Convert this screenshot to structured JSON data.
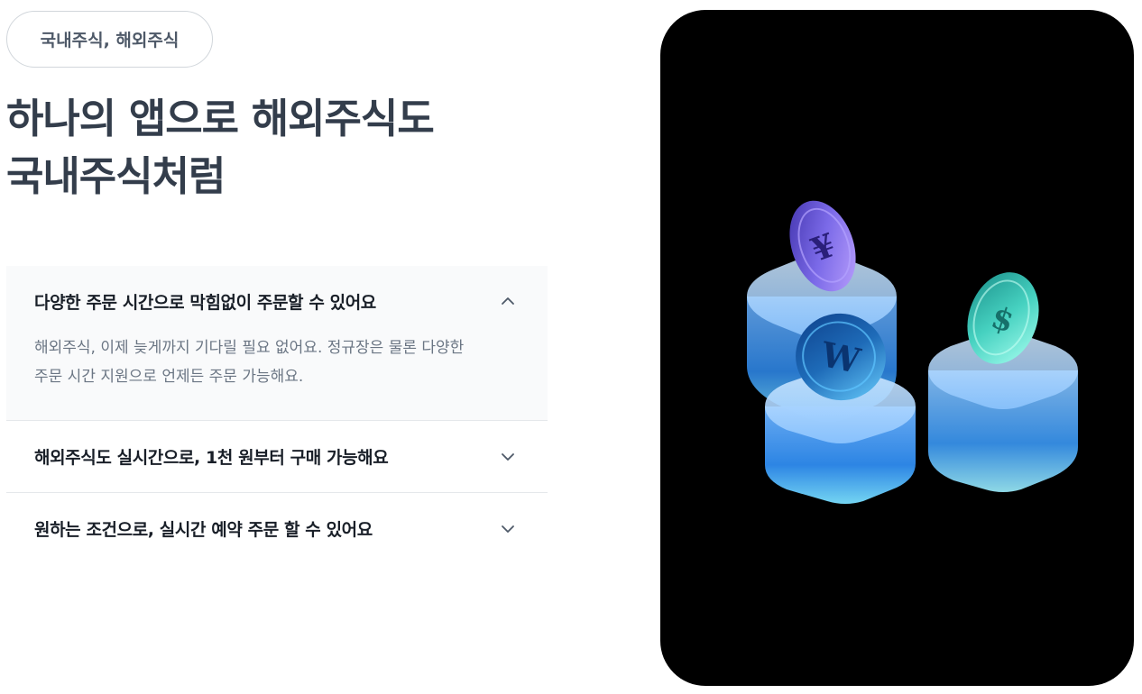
{
  "chip": {
    "label": "국내주식, 해외주식"
  },
  "headline": {
    "line1": "하나의 앱으로 해외주식도",
    "line2": "국내주식처럼"
  },
  "accordion": {
    "items": [
      {
        "title": "다양한 주문 시간으로 막힘없이 주문할 수 있어요",
        "expanded": true,
        "body_line1": "해외주식, 이제 늦게까지 기다릴 필요 없어요. 정규장은 물론 다양한",
        "body_line2": "주문 시간 지원으로 언제든 주문 가능해요."
      },
      {
        "title": "해외주식도 실시간으로, 1천 원부터 구매 가능해요",
        "expanded": false
      },
      {
        "title": "원하는 조건으로, 실시간 예약 주문 할 수 있어요",
        "expanded": false
      }
    ]
  },
  "illustration": {
    "coins": [
      {
        "symbol": "¥",
        "color": "#6b5bd6"
      },
      {
        "symbol": "W",
        "color": "#1e6bb8"
      },
      {
        "symbol": "$",
        "color": "#2fb8a8"
      }
    ],
    "background": "#000000"
  }
}
